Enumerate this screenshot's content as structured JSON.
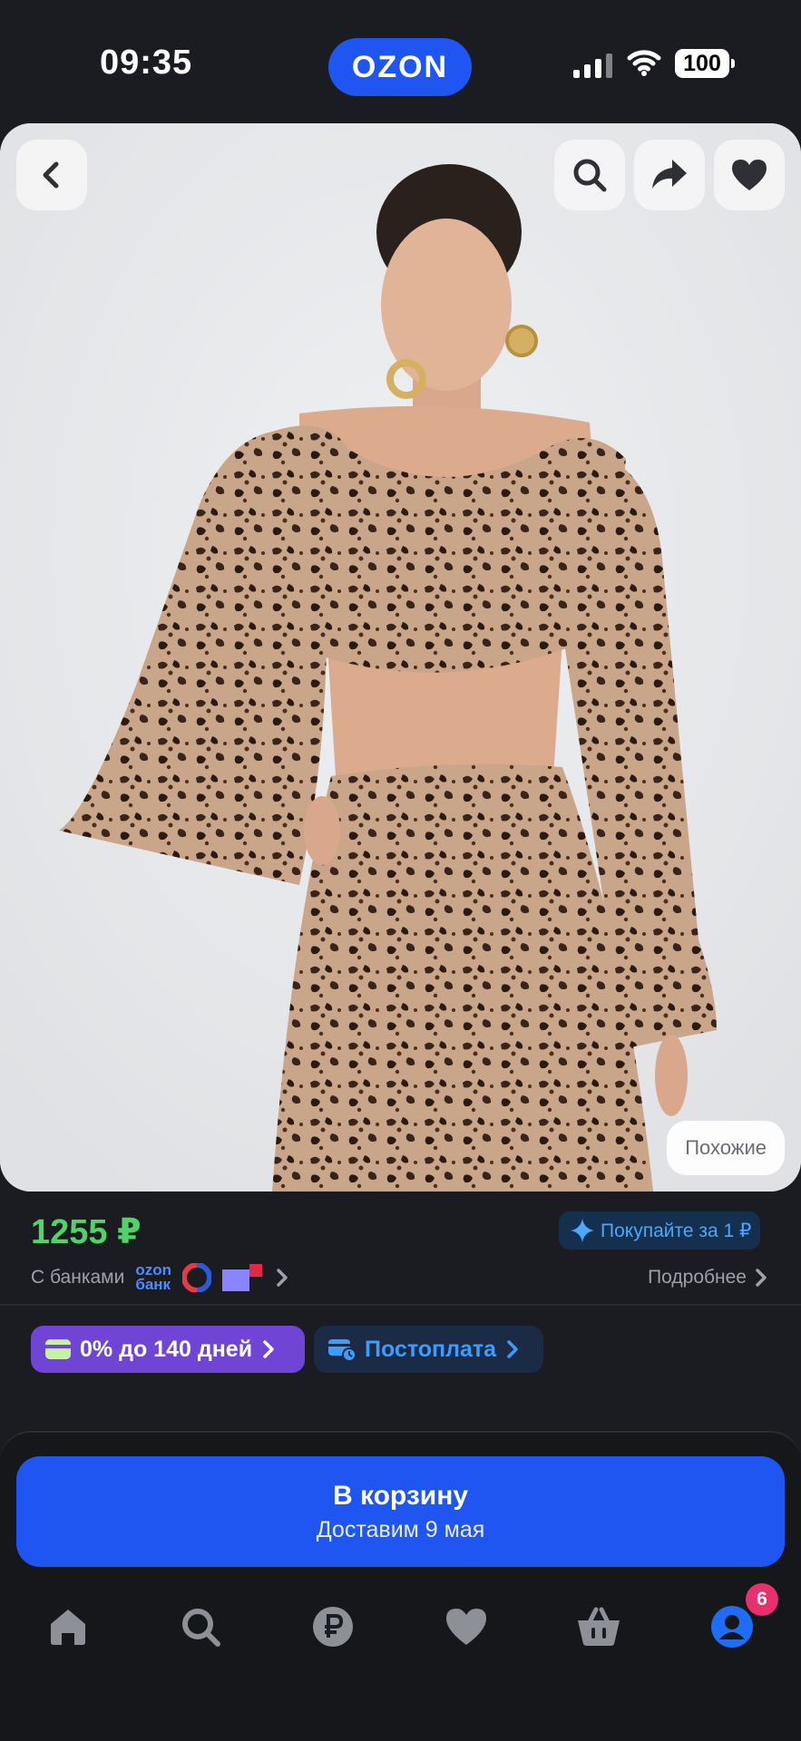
{
  "status_bar": {
    "time": "09:35",
    "app_logo": "OZON",
    "battery": "100"
  },
  "gallery": {
    "similar_label": "Похожие"
  },
  "price": {
    "value": "1255 ₽",
    "promo_badge": "Покупайте за 1 ₽",
    "banks_label": "С банками",
    "ozon_bank_line1": "ozon",
    "ozon_bank_line2": "банк",
    "details_label": "Подробнее"
  },
  "payment_chips": [
    {
      "label": "0% до 140 дней",
      "icon": "card-icon"
    },
    {
      "label": "Постоплата",
      "icon": "postpay-icon"
    }
  ],
  "cart_button": {
    "title": "В корзину",
    "subtitle": "Доставим 9 мая"
  },
  "tab_bar": {
    "items": [
      {
        "name": "home",
        "icon": "home-icon"
      },
      {
        "name": "search",
        "icon": "search-icon"
      },
      {
        "name": "finance",
        "icon": "ruble-icon"
      },
      {
        "name": "favorites",
        "icon": "heart-icon"
      },
      {
        "name": "cart",
        "icon": "basket-icon"
      },
      {
        "name": "profile",
        "icon": "profile-icon"
      }
    ],
    "profile_badge": "6"
  },
  "colors": {
    "background": "#1b1c21",
    "brand_blue": "#1f55f0",
    "price_green": "#4fd46a",
    "installment_purple": "#7045d6",
    "badge_pink": "#e8306e"
  }
}
